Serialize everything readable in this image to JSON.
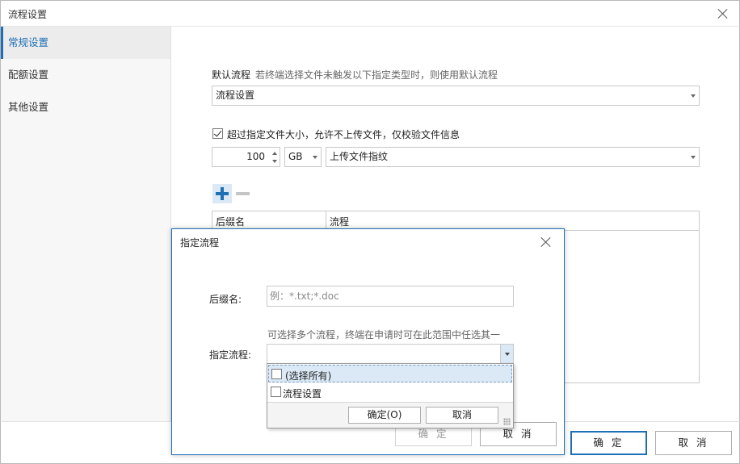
{
  "window": {
    "title": "流程设置"
  },
  "sidebar": {
    "items": [
      {
        "label": "常规设置",
        "active": true
      },
      {
        "label": "配额设置",
        "active": false
      },
      {
        "label": "其他设置",
        "active": false
      }
    ]
  },
  "default_flow": {
    "label": "默认流程",
    "hint": "若终端选择文件未触发以下指定类型时，则使用默认流程",
    "selected": "流程设置"
  },
  "size_limit": {
    "checked": true,
    "label": "超过指定文件大小，允许不上传文件，仅校验文件信息",
    "value": "100",
    "unit": "GB",
    "action": "上传文件指纹"
  },
  "table": {
    "columns": [
      "后缀名",
      "流程"
    ]
  },
  "footer": {
    "confirm": "确 定",
    "cancel": "取 消"
  },
  "dialog": {
    "title": "指定流程",
    "suffix_label": "后缀名:",
    "suffix_placeholder": "例：*.txt;*.doc",
    "flow_hint": "可选择多个流程，终端在申请时可在此范围中任选其一",
    "flow_label": "指定流程:",
    "flow_value": "",
    "confirm": "确 定",
    "cancel": "取 消"
  },
  "popup": {
    "options": [
      {
        "label": "(选择所有)",
        "checked": false
      },
      {
        "label": "流程设置",
        "checked": false
      }
    ],
    "ok": "确定(O)",
    "cancel": "取消"
  },
  "colors": {
    "accent": "#1f6fb5",
    "highlight": "#dbe8f5"
  }
}
